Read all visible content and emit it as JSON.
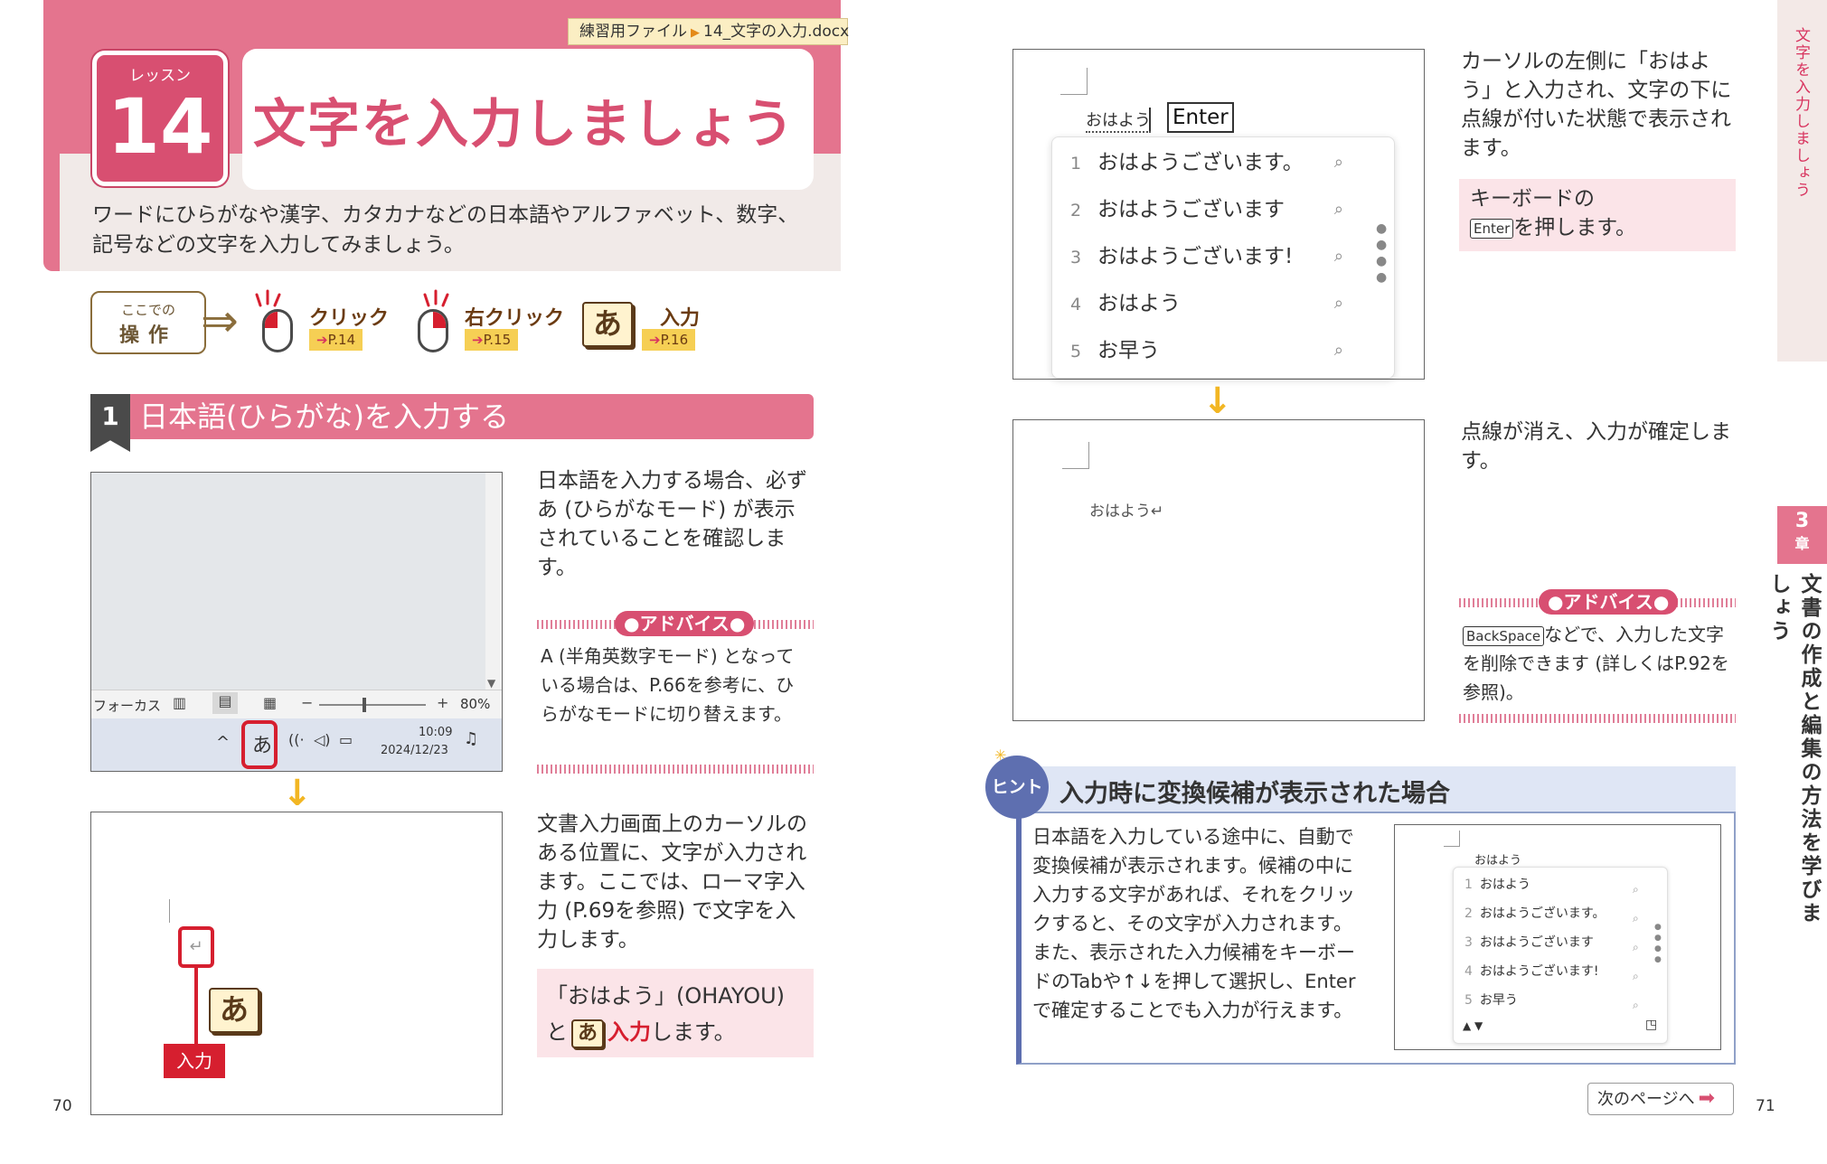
{
  "header": {
    "file_label": "練習用ファイル",
    "file_name": "14_文字の入力.docx",
    "lesson_label": "レッスン",
    "lesson_number": "14",
    "title": "文字を入力しましょう",
    "intro_line1": "ワードにひらがなや漢字、カタカナなどの日本語やアルファベット、数字、",
    "intro_line2": "記号などの文字を入力してみましょう。"
  },
  "operations": {
    "label_top": "ここでの",
    "label_bottom": "操作",
    "items": [
      {
        "label": "クリック",
        "ref": "P.14",
        "icon": "left-click-icon"
      },
      {
        "label": "右クリック",
        "ref": "P.15",
        "icon": "right-click-icon"
      },
      {
        "label": "入力",
        "ref": "P.16",
        "icon": "ime-a-key-icon"
      }
    ]
  },
  "section1": {
    "number": "1",
    "title": "日本語(ひらがな)を入力する"
  },
  "step1": {
    "text": "日本語を入力する場合、必ず あ (ひらがなモード) が表示されていることを確認します。",
    "taskbar": {
      "focus": "フォーカス",
      "zoom": "80%",
      "ime": "あ",
      "time": "10:09",
      "date": "2024/12/23"
    }
  },
  "advice1": {
    "label": "●アドバイス●",
    "text": "A (半角英数字モード) となっている場合は、P.66を参考に、ひらがなモードに切り替えます。"
  },
  "step2": {
    "text": "文書入力画面上のカーソルのある位置に、文字が入力されます。ここでは、ローマ字入力 (P.69を参照) で文字を入力します。",
    "callout_label": "入力",
    "ime_key": "あ",
    "note_line1": "「おはよう」(OHAYOU)",
    "note_line2_pre": "と",
    "note_line2_key": "あ",
    "note_line2_em": "入力",
    "note_line2_post": "します。"
  },
  "step3": {
    "typed": "おはよう",
    "key": "Enter",
    "candidates": [
      {
        "num": "1",
        "text": "おはようございます。"
      },
      {
        "num": "2",
        "text": "おはようございます"
      },
      {
        "num": "3",
        "text": "おはようございます!"
      },
      {
        "num": "4",
        "text": "おはよう"
      },
      {
        "num": "5",
        "text": "お早う"
      }
    ],
    "text": "カーソルの左側に「おはよう」と入力され、文字の下に点線が付いた状態で表示されます。",
    "note_line1": "キーボードの",
    "note_key": "Enter",
    "note_line2": "を押します。"
  },
  "step4": {
    "typed": "おはよう↵",
    "text": "点線が消え、入力が確定します。"
  },
  "advice2": {
    "label": "●アドバイス●",
    "key": "BackSpace",
    "text": "などで、入力した文字を削除できます (詳しくはP.92を参照)。"
  },
  "hint": {
    "badge": "ヒント",
    "title": "入力時に変換候補が表示された場合",
    "text": "日本語を入力している途中に、自動で変換候補が表示されます。候補の中に入力する文字があれば、それをクリックすると、その文字が入力されます。また、表示された入力候補をキーボードのTabや↑↓を押して選択し、Enterで確定することでも入力が行えます。",
    "mini_typed": "おはよう",
    "mini_candidates": [
      {
        "num": "1",
        "text": "おはよう"
      },
      {
        "num": "2",
        "text": "おはようございます。"
      },
      {
        "num": "3",
        "text": "おはようございます"
      },
      {
        "num": "4",
        "text": "おはようございます!"
      },
      {
        "num": "5",
        "text": "お早う"
      }
    ]
  },
  "sidebar": {
    "running_title": "文字を入力しましょう",
    "chapter_num": "3",
    "chapter_label": "章",
    "chapter_title": "文書の作成と編集の方法を学びましょう"
  },
  "footer": {
    "next_label": "次のページへ",
    "page_left": "70",
    "page_right": "71"
  },
  "colors": {
    "accent_pink": "#e4748e",
    "deep_pink": "#d84f71",
    "callout_red": "#d61f2f",
    "arrow_yellow": "#f2b623",
    "hint_blue": "#5e6fb0"
  }
}
